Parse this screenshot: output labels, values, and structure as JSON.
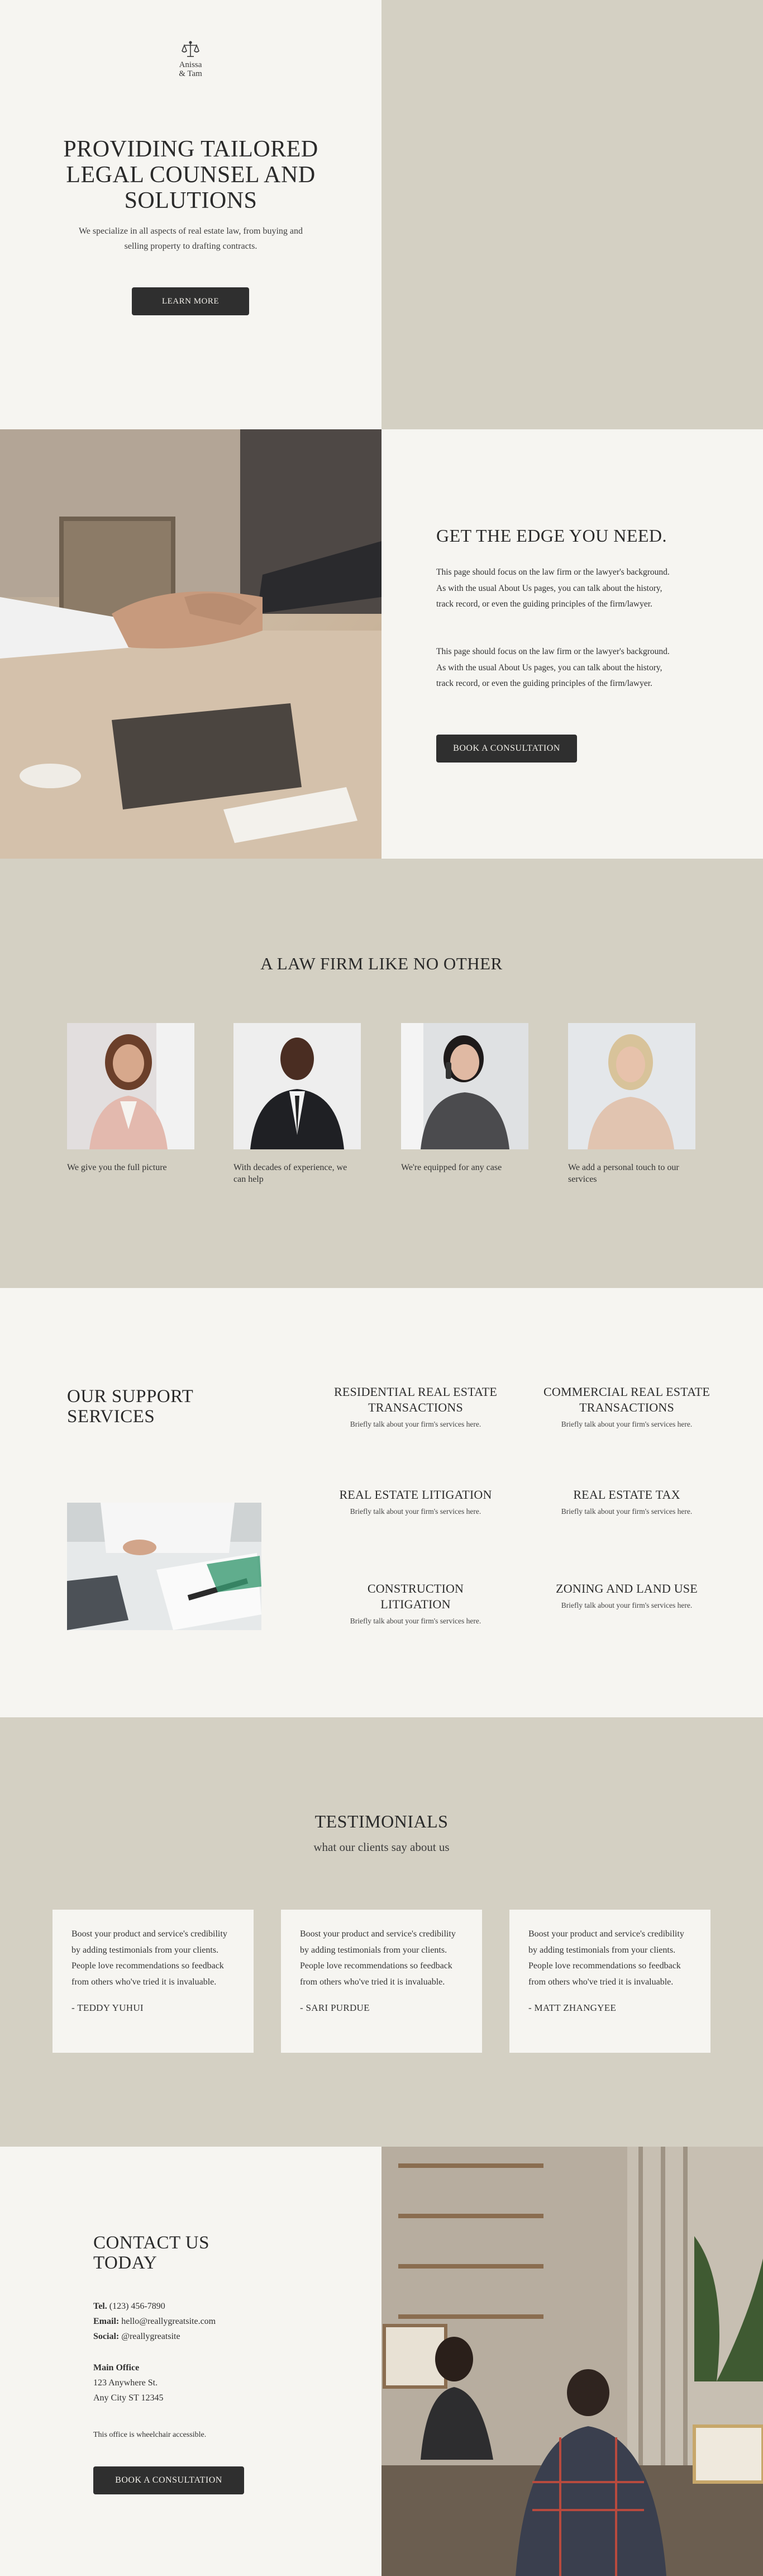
{
  "colors": {
    "cream": "#f6f5f1",
    "taupe": "#d4d0c3",
    "button": "#2f2f2f",
    "button_text": "#f2f0ea",
    "text": "#2b2b2b"
  },
  "brand": {
    "name_line1": "Anissa",
    "name_line2": "& Tam",
    "logo_icon": "scales-of-justice-icon"
  },
  "hero": {
    "title": "PROVIDING TAILORED LEGAL COUNSEL AND SOLUTIONS",
    "text": "We specialize in all aspects of real estate law, from buying and selling property to drafting contracts.",
    "button": "LEARN MORE",
    "photo": "lawyer-portrait-photo"
  },
  "edge": {
    "title": "GET THE EDGE YOU NEED.",
    "p1": "This page should focus on the law firm or the lawyer's background. As with the usual About Us pages, you can talk about the history, track record, or even the guiding principles of the firm/lawyer.",
    "p2": "This page should focus on the law firm or the lawyer's background. As with the usual About Us pages, you can talk about the history, track record, or even the guiding principles of the firm/lawyer.",
    "button": "BOOK A CONSULTATION",
    "photo": "handshake-photo"
  },
  "firm": {
    "title": "A LAW FIRM LIKE NO OTHER",
    "members": [
      {
        "caption": "We give you the full picture"
      },
      {
        "caption": "With decades of experience, we can help"
      },
      {
        "caption": "We're equipped for any case"
      },
      {
        "caption": "We add a personal touch to our services"
      }
    ]
  },
  "services": {
    "title": "OUR SUPPORT SERVICES",
    "photo": "contract-signing-photo",
    "items": [
      {
        "heading": "RESIDENTIAL REAL ESTATE TRANSACTIONS",
        "desc": "Briefly talk about your firm's services here."
      },
      {
        "heading": "COMMERCIAL REAL ESTATE TRANSACTIONS",
        "desc": "Briefly talk about your firm's services here."
      },
      {
        "heading": "REAL ESTATE LITIGATION",
        "desc": "Briefly talk about your firm's services here."
      },
      {
        "heading": "REAL ESTATE TAX",
        "desc": "Briefly talk about your firm's services here."
      },
      {
        "heading": "CONSTRUCTION LITIGATION",
        "desc": "Briefly talk about your firm's services here."
      },
      {
        "heading": "ZONING AND LAND USE",
        "desc": "Briefly talk about your firm's services here."
      }
    ]
  },
  "testimonials": {
    "title": "TESTIMONIALS",
    "subtitle": "what our clients say about us",
    "items": [
      {
        "quote": "Boost your product and service's credibility by adding testimonials from your clients. People love recommendations so feedback from others who've tried it is invaluable.",
        "author": "- TEDDY YUHUI"
      },
      {
        "quote": "Boost your product and service's credibility by adding testimonials from your clients. People love recommendations so feedback from others who've tried it is invaluable.",
        "author": "- SARI PURDUE"
      },
      {
        "quote": "Boost your product and service's credibility by adding testimonials from your clients. People love recommendations so feedback from others who've tried it is invaluable.",
        "author": "- MATT ZHANGYEE"
      }
    ]
  },
  "contact": {
    "title": "CONTACT US TODAY",
    "tel_label": "Tel.",
    "tel": "(123) 456-7890",
    "email_label": "Email:",
    "email": "hello@reallygreatsite.com",
    "social_label": "Social:",
    "social": "@reallygreatsite",
    "office_label": "Main Office",
    "address1": "123 Anywhere St.",
    "address2": "Any City ST 12345",
    "note": "This office is wheelchair accessible.",
    "button": "BOOK A CONSULTATION",
    "photo": "office-meeting-photo"
  }
}
